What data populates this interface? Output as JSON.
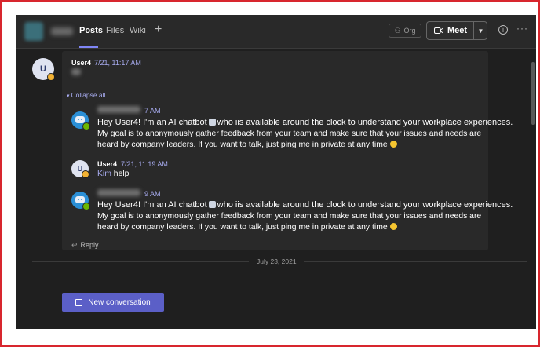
{
  "tabs": [
    {
      "label": "Posts",
      "active": true
    },
    {
      "label": "Files",
      "active": false
    },
    {
      "label": "Wiki",
      "active": false
    }
  ],
  "add_tab_label": "+",
  "header": {
    "org_label": "Org",
    "meet_label": "Meet",
    "info_icon": "info-icon",
    "more_label": "···"
  },
  "thread": {
    "root": {
      "avatar_initial": "U",
      "author": "User4",
      "time": "7/21, 11:17 AM"
    },
    "collapse_label": "Collapse all",
    "replies": [
      {
        "time_suffix": "7 AM",
        "lines": [
          "Hey User4! I'm an AI chatbot",
          "who iis available around the clock to understand your workplace experiences.",
          "My goal is to anonymously gather feedback from your team and make sure that your issues and needs are",
          "heard by company leaders. If you want to talk, just ping me in private at any time"
        ]
      },
      {
        "avatar_initial": "U",
        "author": "User4",
        "time": "7/21, 11:19 AM",
        "mention": "Kim",
        "text": "help"
      },
      {
        "time_suffix": "9 AM",
        "lines": [
          "Hey User4! I'm an AI chatbot",
          "who iis available around the clock to understand your workplace experiences.",
          "My goal is to anonymously gather feedback from your team and make sure that your issues and needs are",
          "heard by company leaders. If you want to talk, just ping me in private at any time"
        ]
      }
    ],
    "reply_label": "Reply"
  },
  "date_divider": "July 23, 2021",
  "new_conversation_label": "New conversation",
  "colors": {
    "accent": "#5b5fc7",
    "link": "#a7abef",
    "frame": "#d8262e"
  }
}
